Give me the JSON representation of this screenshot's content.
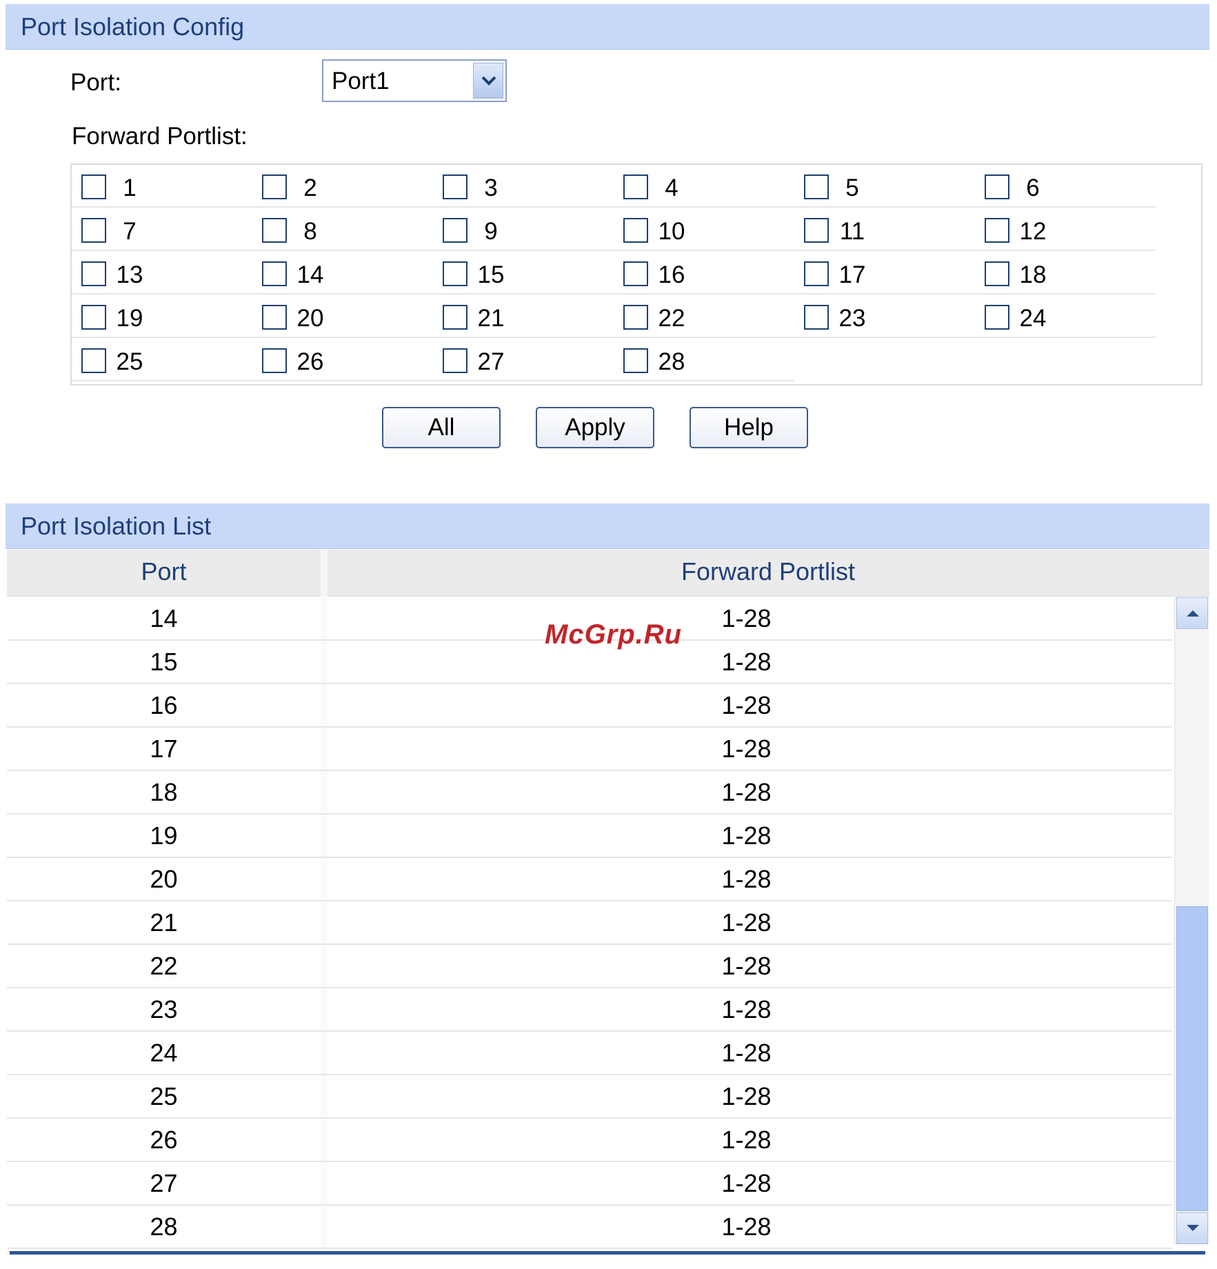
{
  "config": {
    "title": "Port Isolation Config",
    "port_label": "Port:",
    "port_value": "Port1",
    "forward_label": "Forward Portlist:",
    "ports": [
      "1",
      "2",
      "3",
      "4",
      "5",
      "6",
      "7",
      "8",
      "9",
      "10",
      "11",
      "12",
      "13",
      "14",
      "15",
      "16",
      "17",
      "18",
      "19",
      "20",
      "21",
      "22",
      "23",
      "24",
      "25",
      "26",
      "27",
      "28"
    ],
    "buttons": {
      "all": "All",
      "apply": "Apply",
      "help": "Help"
    }
  },
  "list": {
    "title": "Port Isolation List",
    "headers": {
      "port": "Port",
      "forward": "Forward Portlist"
    },
    "rows": [
      {
        "port": "14",
        "forward": "1-28"
      },
      {
        "port": "15",
        "forward": "1-28"
      },
      {
        "port": "16",
        "forward": "1-28"
      },
      {
        "port": "17",
        "forward": "1-28"
      },
      {
        "port": "18",
        "forward": "1-28"
      },
      {
        "port": "19",
        "forward": "1-28"
      },
      {
        "port": "20",
        "forward": "1-28"
      },
      {
        "port": "21",
        "forward": "1-28"
      },
      {
        "port": "22",
        "forward": "1-28"
      },
      {
        "port": "23",
        "forward": "1-28"
      },
      {
        "port": "24",
        "forward": "1-28"
      },
      {
        "port": "25",
        "forward": "1-28"
      },
      {
        "port": "26",
        "forward": "1-28"
      },
      {
        "port": "27",
        "forward": "1-28"
      },
      {
        "port": "28",
        "forward": "1-28"
      }
    ]
  },
  "watermark": "McGrp.Ru",
  "colors": {
    "header_bg": "#c7d8f9",
    "header_text": "#1e3f7a",
    "scroll_thumb": "#b0c8f4"
  }
}
